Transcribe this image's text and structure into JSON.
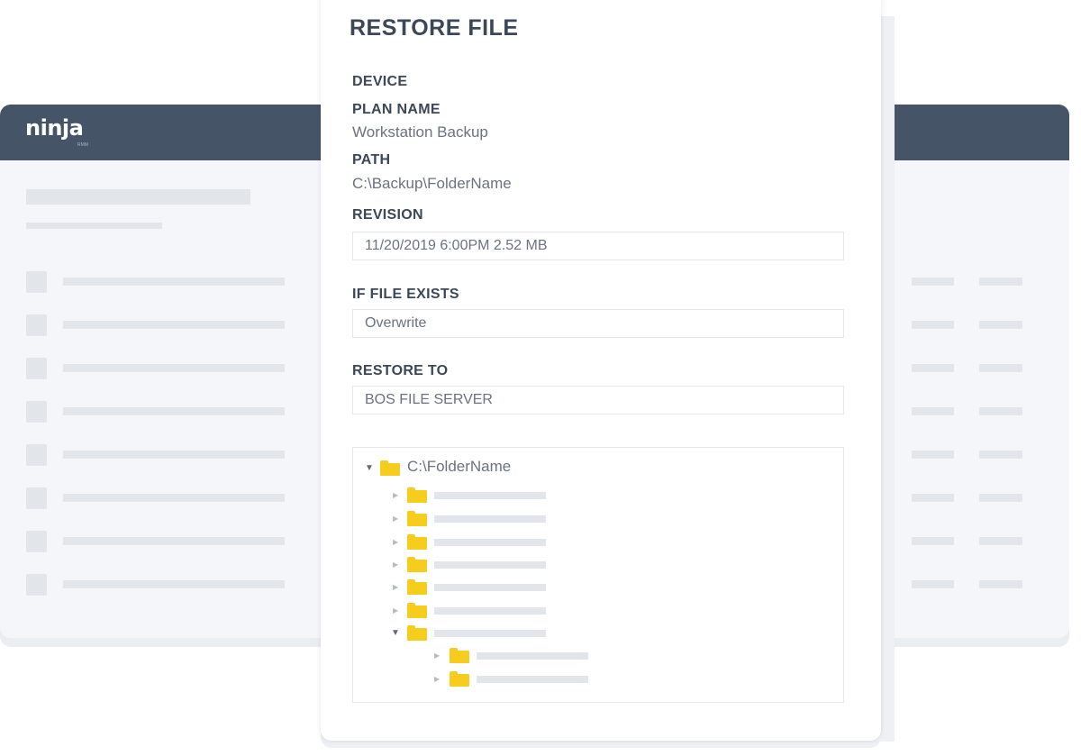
{
  "app": {
    "logo": "ninja",
    "logo_sub": "RMM"
  },
  "dialog": {
    "title": "RESTORE FILE",
    "device_label": "DEVICE",
    "plan_name_label": "PLAN NAME",
    "plan_name_value": "Workstation Backup",
    "path_label": "PATH",
    "path_value": "C:\\Backup\\FolderName",
    "revision_label": "REVISION",
    "revision_value": "11/20/2019 6:00PM 2.52 MB",
    "if_exists_label": "IF FILE EXISTS",
    "if_exists_value": "Overwrite",
    "restore_to_label": "RESTORE TO",
    "restore_to_value": "BOS FILE SERVER"
  },
  "tree": {
    "root_label": "C:\\FolderName",
    "icons": {
      "folder": "folder-icon",
      "expand": "caret-right-icon",
      "collapse": "caret-down-icon"
    }
  },
  "colors": {
    "header": "#465468",
    "folder": "#f6cd1c",
    "label": "#3c4758",
    "value": "#6b7280"
  }
}
